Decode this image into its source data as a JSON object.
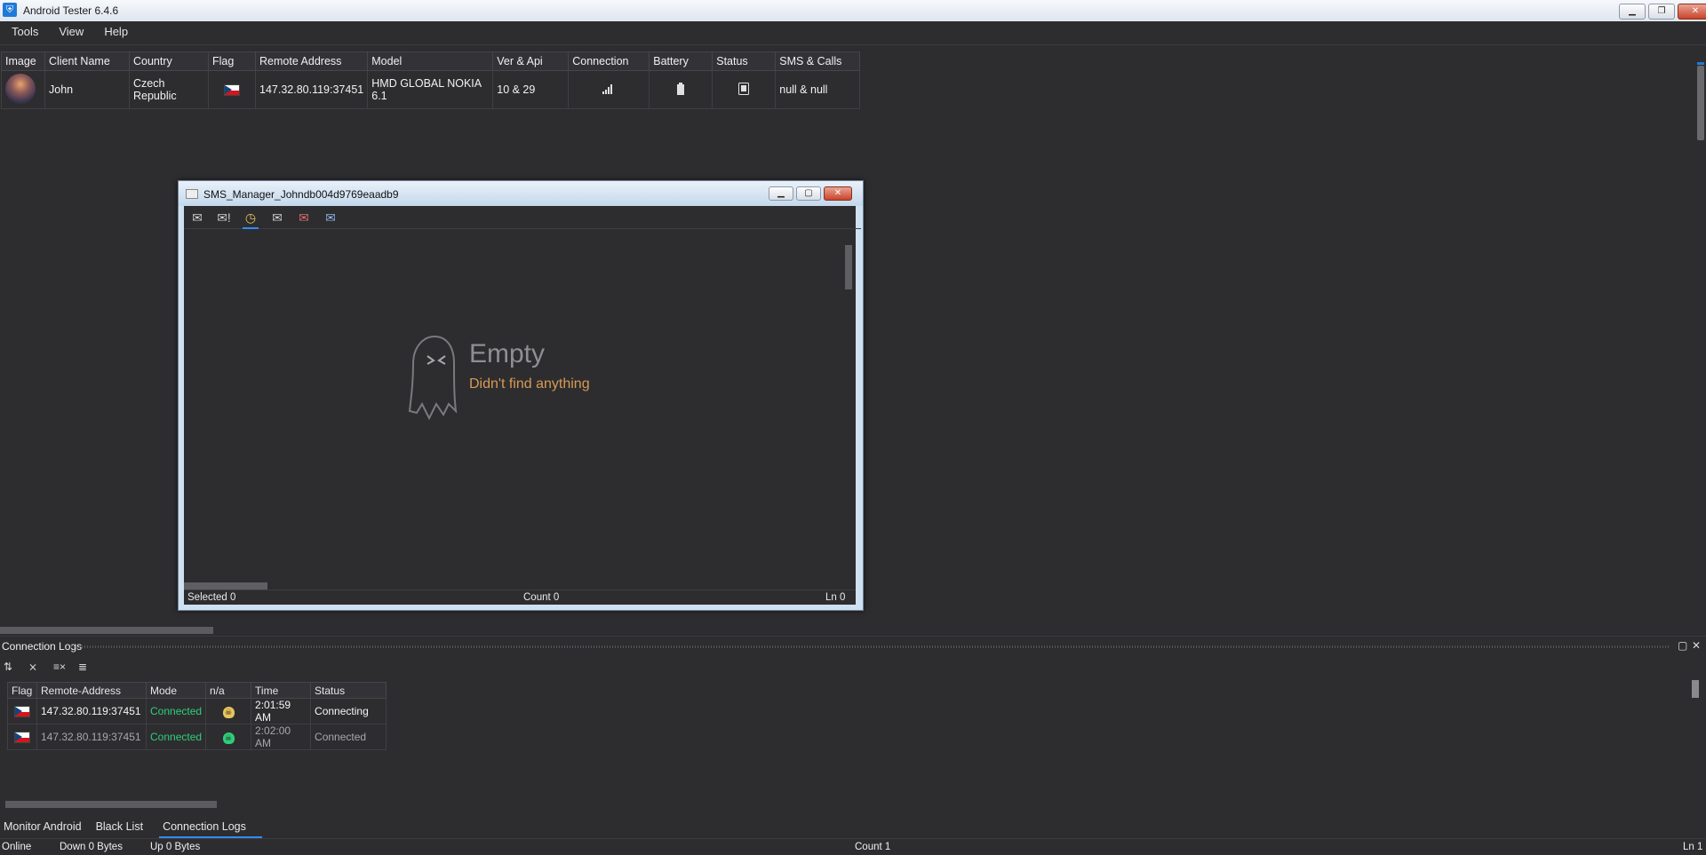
{
  "window": {
    "title": "Android Tester 6.4.6"
  },
  "menu": [
    "Tools",
    "View",
    "Help"
  ],
  "clients": {
    "headers": [
      "Image",
      "Client Name",
      "Country",
      "Flag",
      "Remote Address",
      "Model",
      "Ver & Api",
      "Connection",
      "Battery",
      "Status",
      "SMS & Calls"
    ],
    "rows": [
      {
        "name": "John",
        "country": "Czech Republic",
        "address": "147.32.80.119:37451",
        "model": "HMD GLOBAL NOKIA 6.1",
        "ver": "10 & 29",
        "connection_icon": "signal-icon",
        "battery_icon": "battery-icon",
        "status_icon": "phone-status-icon",
        "sms": "null & null"
      }
    ]
  },
  "sms_window": {
    "title": "SMS_Manager_Johndb004d9769eaadb9",
    "toolbar": [
      "inbox-icon",
      "unread-mail-icon",
      "history-icon",
      "sent-mail-icon",
      "delete-mail-icon",
      "draft-mail-icon"
    ],
    "empty_title": "Empty",
    "empty_subtitle": "Didn't find anything",
    "status": {
      "selected": "Selected 0",
      "count": "Count 0",
      "line": "Ln 0"
    }
  },
  "logs": {
    "title": "Connection Logs",
    "headers": [
      "Flag",
      "Remote-Address",
      "Mode",
      "n/a",
      "Time",
      "Status"
    ],
    "rows": [
      {
        "address": "147.32.80.119:37451",
        "mode": "Connected",
        "skull_color": "#e8c45a",
        "time": "2:01:59 AM",
        "status": "Connecting"
      },
      {
        "address": "147.32.80.119:37451",
        "mode": "Connected",
        "skull_color": "#2fce7a",
        "time": "2:02:00 AM",
        "status": "Connected"
      }
    ]
  },
  "tabs": [
    "Monitor Android",
    "Black List",
    "Connection Logs"
  ],
  "statusbar": {
    "online": "Online",
    "down": "Down 0 Bytes",
    "up": "Up 0 Bytes",
    "count": "Count 1",
    "line": "Ln 1"
  },
  "colors": {
    "accent": "#2f8df5",
    "connected": "#2fce7a",
    "empty_sub": "#d99a54"
  }
}
